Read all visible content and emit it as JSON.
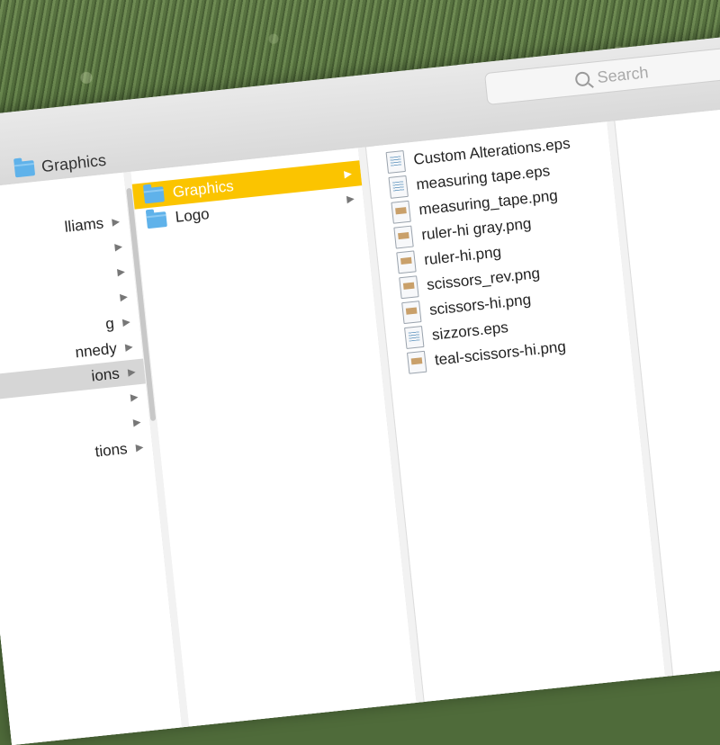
{
  "search": {
    "placeholder": "Search"
  },
  "path": {
    "folder": "Graphics"
  },
  "column1": {
    "items": [
      {
        "label": "lliams",
        "arrow": "▶"
      },
      {
        "label": "",
        "arrow": "▶"
      },
      {
        "label": "",
        "arrow": "▶"
      },
      {
        "label": "",
        "arrow": "▶"
      },
      {
        "label": "g",
        "arrow": "▶"
      },
      {
        "label": "nnedy",
        "arrow": "▶"
      },
      {
        "label": "ions",
        "arrow": "▶"
      },
      {
        "label": "",
        "arrow": "▶"
      },
      {
        "label": "",
        "arrow": "▶"
      },
      {
        "label": "tions",
        "arrow": "▶"
      }
    ]
  },
  "column2": {
    "items": [
      {
        "label": "Graphics",
        "arrow": "▶"
      },
      {
        "label": "Logo",
        "arrow": "▶"
      }
    ]
  },
  "column3": {
    "files": [
      {
        "name": "Custom Alterations.eps",
        "icon": "eps-file-icon"
      },
      {
        "name": "measuring tape.eps",
        "icon": "eps-file-icon"
      },
      {
        "name": "measuring_tape.png",
        "icon": "png-file-icon"
      },
      {
        "name": "ruler-hi gray.png",
        "icon": "png-file-icon"
      },
      {
        "name": "ruler-hi.png",
        "icon": "png-file-icon"
      },
      {
        "name": "scissors_rev.png",
        "icon": "png-file-icon"
      },
      {
        "name": "scissors-hi.png",
        "icon": "png-file-icon"
      },
      {
        "name": "sizzors.eps",
        "icon": "eps-file-icon"
      },
      {
        "name": "teal-scissors-hi.png",
        "icon": "png-file-icon"
      }
    ]
  },
  "colors": {
    "selection": "#fbc400",
    "folder": "#5fb2ea"
  }
}
